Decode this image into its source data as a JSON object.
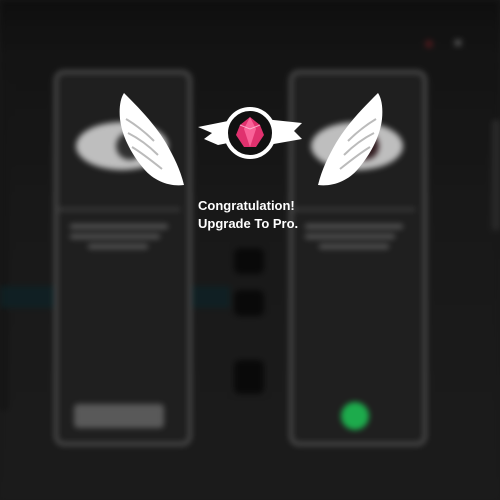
{
  "dialog": {
    "line1": "Congratulation!",
    "line2": "Upgrade To Pro."
  },
  "icons": {
    "close": "×",
    "badge": "pink-gem-with-wings"
  },
  "colors": {
    "gem": "#e0316e",
    "accent_green": "#24d15d",
    "text": "#ffffff",
    "background": "#1f1f1f"
  }
}
